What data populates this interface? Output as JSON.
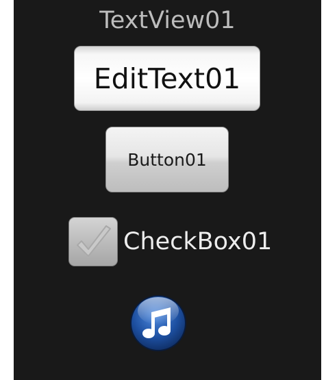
{
  "textview": {
    "text": "TextView01"
  },
  "edittext": {
    "value": "EditText01"
  },
  "button": {
    "label": "Button01"
  },
  "checkbox": {
    "label": "CheckBox01",
    "checked": false
  },
  "image": {
    "icon": "music-note-icon"
  },
  "colors": {
    "background": "#191919",
    "text_secondary": "#bdbdbd",
    "text_primary": "#ededed",
    "icon_blue": "#1f56a8"
  }
}
